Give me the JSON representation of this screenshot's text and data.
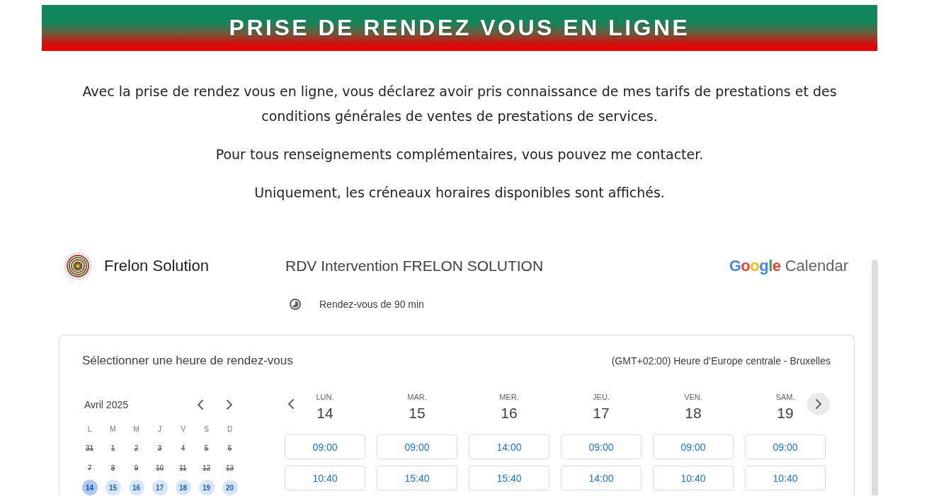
{
  "banner": {
    "title": "PRISE DE RENDEZ VOUS EN LIGNE"
  },
  "intro": [
    "Avec la prise de rendez vous en ligne, vous déclarez avoir pris connaissance de mes tarifs de prestations et des conditions générales de ventes de prestations de services.",
    "Pour tous renseignements complémentaires, vous pouvez me contacter.",
    "Uniquement, les créneaux horaires disponibles sont affichés."
  ],
  "booking": {
    "owner": {
      "name": "Frelon Solution"
    },
    "title": "RDV Intervention FRELON SOLUTION",
    "duration": "Rendez-vous de 90 min",
    "provider": {
      "brand": "Google",
      "product": "Calendar"
    },
    "panel": {
      "heading": "Sélectionner une heure de rendez-vous",
      "timezone": "(GMT+02:00) Heure d’Europe centrale - Bruxelles",
      "month": {
        "label": "Avril 2025",
        "weekdays": [
          "L",
          "M",
          "M",
          "J",
          "V",
          "S",
          "D"
        ],
        "weeks": [
          [
            {
              "day": "31",
              "available": false,
              "selected": false
            },
            {
              "day": "1",
              "available": false,
              "selected": false
            },
            {
              "day": "2",
              "available": false,
              "selected": false
            },
            {
              "day": "3",
              "available": false,
              "selected": false
            },
            {
              "day": "4",
              "available": false,
              "selected": false
            },
            {
              "day": "5",
              "available": false,
              "selected": false
            },
            {
              "day": "6",
              "available": false,
              "selected": false
            }
          ],
          [
            {
              "day": "7",
              "available": false,
              "selected": false
            },
            {
              "day": "8",
              "available": false,
              "selected": false
            },
            {
              "day": "9",
              "available": false,
              "selected": false
            },
            {
              "day": "10",
              "available": false,
              "selected": false
            },
            {
              "day": "11",
              "available": false,
              "selected": false
            },
            {
              "day": "12",
              "available": false,
              "selected": false
            },
            {
              "day": "13",
              "available": false,
              "selected": false
            }
          ],
          [
            {
              "day": "14",
              "available": true,
              "selected": true
            },
            {
              "day": "15",
              "available": true,
              "selected": false
            },
            {
              "day": "16",
              "available": true,
              "selected": false
            },
            {
              "day": "17",
              "available": true,
              "selected": false
            },
            {
              "day": "18",
              "available": true,
              "selected": false
            },
            {
              "day": "19",
              "available": true,
              "selected": false
            },
            {
              "day": "20",
              "available": true,
              "selected": false
            }
          ]
        ]
      },
      "days": [
        {
          "weekday": "LUN.",
          "date": "14",
          "slots": [
            "09:00",
            "10:40"
          ]
        },
        {
          "weekday": "MAR.",
          "date": "15",
          "slots": [
            "09:00",
            "15:40"
          ]
        },
        {
          "weekday": "MER.",
          "date": "16",
          "slots": [
            "14:00",
            "15:40"
          ]
        },
        {
          "weekday": "JEU.",
          "date": "17",
          "slots": [
            "09:00",
            "14:00"
          ]
        },
        {
          "weekday": "VEN.",
          "date": "18",
          "slots": [
            "09:00",
            "10:40"
          ]
        },
        {
          "weekday": "SAM.",
          "date": "19",
          "slots": [
            "09:00",
            "10:40"
          ]
        }
      ]
    }
  }
}
